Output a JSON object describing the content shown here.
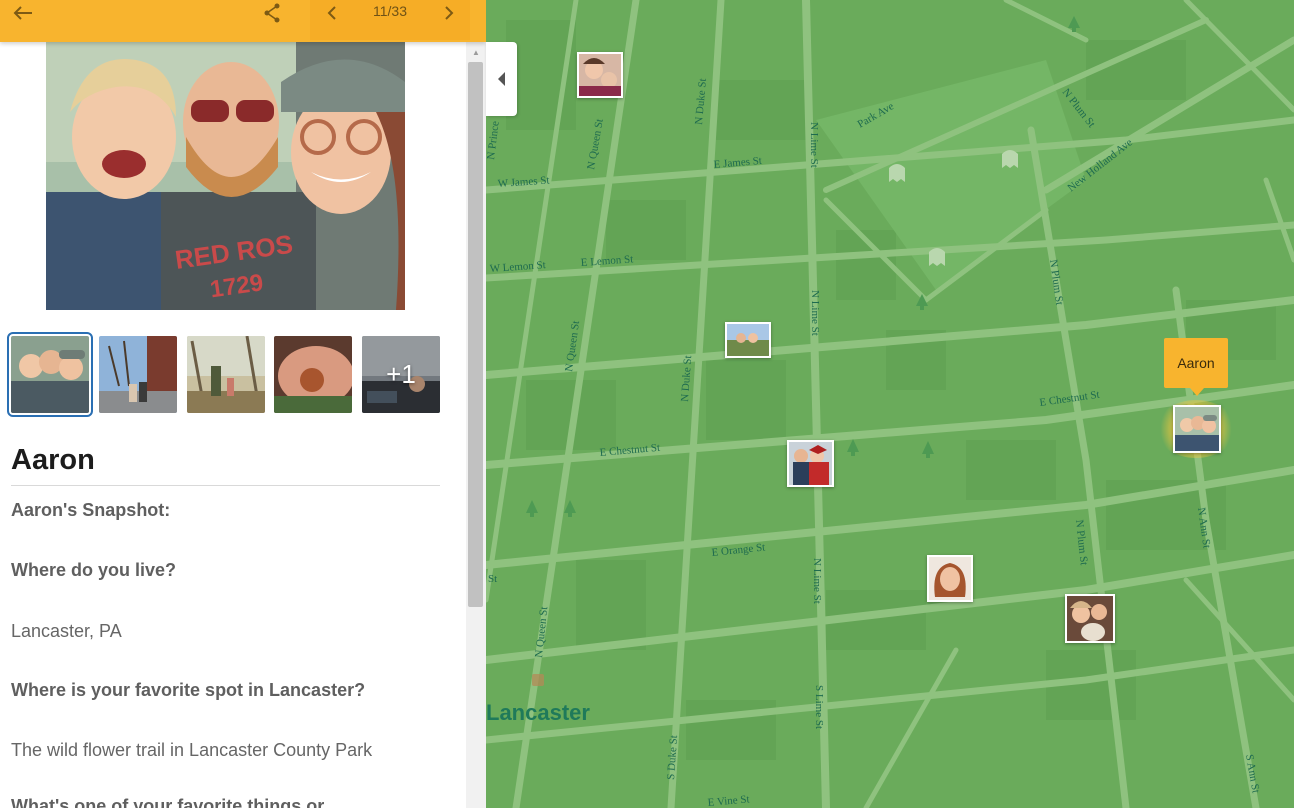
{
  "topbar": {
    "back_icon": "arrow-left-icon",
    "share_icon": "share-icon",
    "prev_icon": "chevron-left-icon",
    "next_icon": "chevron-right-icon",
    "page_indicator": "11/33"
  },
  "gallery": {
    "more_badge": "+1"
  },
  "profile": {
    "name": "Aaron",
    "snapshot_heading": "Aaron's Snapshot:",
    "q1": "Where do you live?",
    "a1": "Lancaster,  PA",
    "q2": "Where is your favorite spot in Lancaster?",
    "a2": "The wild flower trail in Lancaster County Park",
    "q3": "What's one of your favorite things or"
  },
  "map": {
    "city_label": "Lancaster",
    "tooltip_label": "Aaron",
    "streets": {
      "n_prince": "N Prince",
      "n_queen_top": "N Queen St",
      "n_duke_top": "N Duke St",
      "n_lime_top": "N Lime St",
      "park_ave": "Park Ave",
      "n_plum_top": "N Plum St",
      "new_holland": "New Holland Ave",
      "e_james": "E James St",
      "w_james": "W James St",
      "w_lemon": "W Lemon St",
      "e_lemon": "E Lemon St",
      "n_lime_mid": "N Lime St",
      "n_plum_mid": "N Plum St",
      "n_queen_mid": "N Queen St",
      "n_duke_mid": "N Duke St",
      "e_chestnut_left": "E Chestnut St",
      "e_chestnut_right": "E Chestnut St",
      "n_ann_mid": "N Ann St",
      "e_orange": "E Orange St",
      "n_lime_low": "N Lime St",
      "n_plum_low": "N Plum St",
      "n_queen_low": "N Queen St",
      "st_left": "St",
      "s_duke": "S Duke St",
      "s_lime": "S Lime St",
      "s_ann": "S Ann St",
      "e_vine": "E Vine St"
    }
  },
  "colors": {
    "accent": "#f8b42e",
    "map_green": "#6aab5b",
    "selected_outline": "#2a6fb3"
  }
}
